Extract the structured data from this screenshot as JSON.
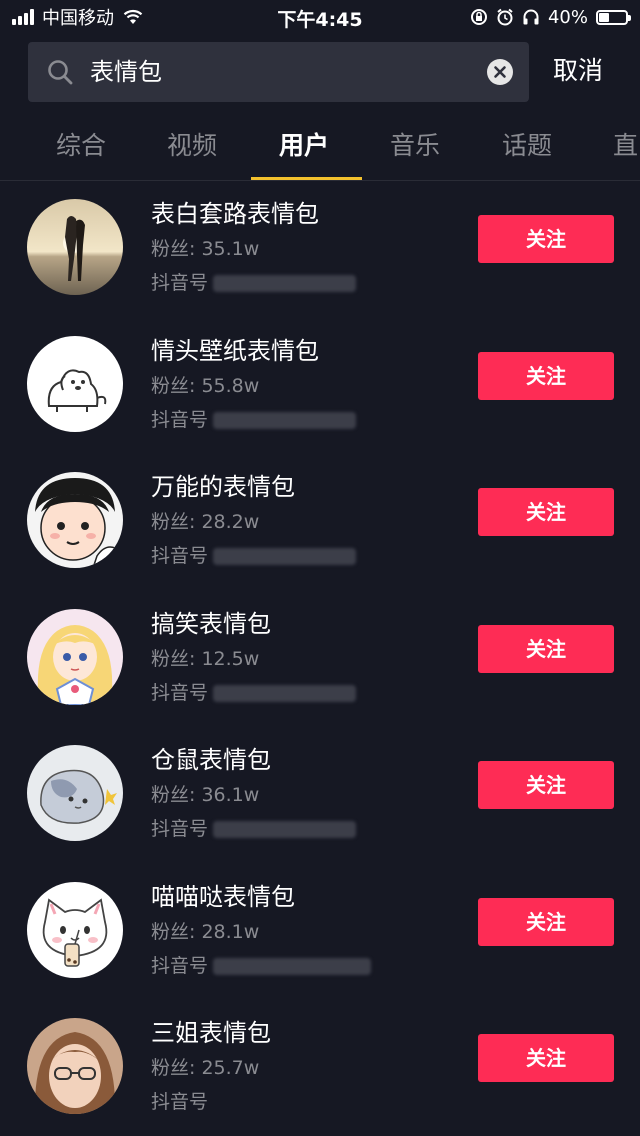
{
  "status_bar": {
    "carrier": "中国移动",
    "time": "下午4:45",
    "battery_text": "40%",
    "battery_level": 0.4
  },
  "search": {
    "value": "表情包",
    "cancel_label": "取消"
  },
  "tabs": [
    {
      "label": "综合",
      "active": false
    },
    {
      "label": "视频",
      "active": false
    },
    {
      "label": "用户",
      "active": true
    },
    {
      "label": "音乐",
      "active": false
    },
    {
      "label": "话题",
      "active": false
    },
    {
      "label": "直",
      "active": false
    }
  ],
  "colors": {
    "background": "#161823",
    "accent": "#fe2c55",
    "tab_indicator": "#f4c12d",
    "secondary_text": "#8a8b91"
  },
  "users": [
    {
      "name": "表白套路表情包",
      "fans": "粉丝: 35.1w",
      "id_label": "抖音号",
      "follow_label": "关注",
      "avatar": "couple-silhouette-avatar"
    },
    {
      "name": "情头壁纸表情包",
      "fans": "粉丝: 55.8w",
      "id_label": "抖音号",
      "follow_label": "关注",
      "avatar": "cartoon-dog-avatar"
    },
    {
      "name": "万能的表情包",
      "fans": "粉丝: 28.2w",
      "id_label": "抖音号",
      "follow_label": "关注",
      "avatar": "cartoon-face-avatar"
    },
    {
      "name": "搞笑表情包",
      "fans": "粉丝: 12.5w",
      "id_label": "抖音号",
      "follow_label": "关注",
      "avatar": "anime-girl-avatar"
    },
    {
      "name": "仓鼠表情包",
      "fans": "粉丝: 36.1w",
      "id_label": "抖音号",
      "follow_label": "关注",
      "avatar": "hamster-avatar"
    },
    {
      "name": "喵喵哒表情包",
      "fans": "粉丝: 28.1w",
      "id_label": "抖音号",
      "follow_label": "关注",
      "avatar": "white-cat-avatar"
    },
    {
      "name": "三姐表情包",
      "fans": "粉丝: 25.7w",
      "id_label": "抖音号",
      "follow_label": "关注",
      "avatar": "woman-glasses-avatar"
    }
  ]
}
